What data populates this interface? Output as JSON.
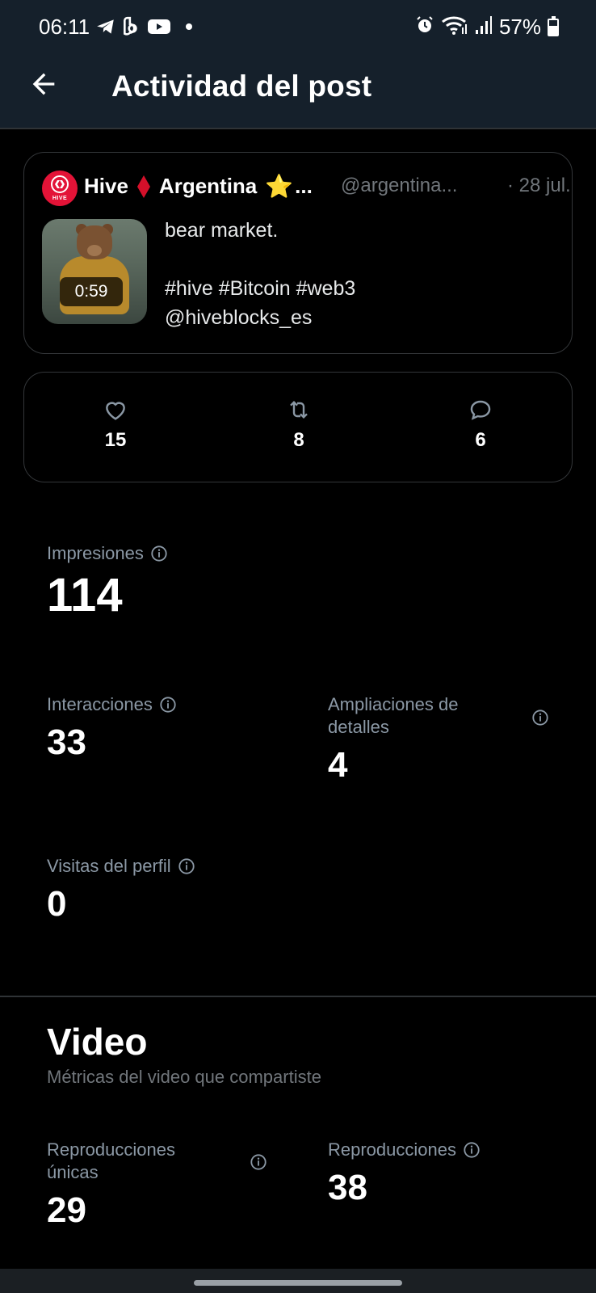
{
  "status_bar": {
    "time": "06:11",
    "battery": "57%",
    "battery_level": 0.57
  },
  "header": {
    "title": "Actividad del post"
  },
  "post": {
    "author_name_part1": "Hive",
    "author_name_part2": "Argentina",
    "name_emoji": "⭐",
    "name_ellipsis": "...",
    "avatar_text": "HIVE",
    "handle": "@argentina...",
    "date": "· 28 jul.",
    "video_duration": "0:59",
    "text_line1": "bear market.",
    "text_line2": "#hive #Bitcoin #web3",
    "text_line3": "@hiveblocks_es"
  },
  "engagement": {
    "likes": "15",
    "reposts": "8",
    "replies": "6"
  },
  "metrics": {
    "impressions_label": "Impresiones",
    "impressions_value": "114",
    "interactions_label": "Interacciones",
    "interactions_value": "33",
    "detail_expands_label": "Ampliaciones de detalles",
    "detail_expands_value": "4",
    "profile_visits_label": "Visitas del perfil",
    "profile_visits_value": "0"
  },
  "video": {
    "title": "Video",
    "subtitle": "Métricas del video que compartiste",
    "unique_views_label": "Reproducciones únicas",
    "unique_views_value": "29",
    "views_label": "Reproducciones",
    "views_value": "38"
  },
  "colors": {
    "header_bg": "#15202b",
    "background": "#000000",
    "muted_text": "#8b98a5",
    "brand_red": "#e31337"
  }
}
